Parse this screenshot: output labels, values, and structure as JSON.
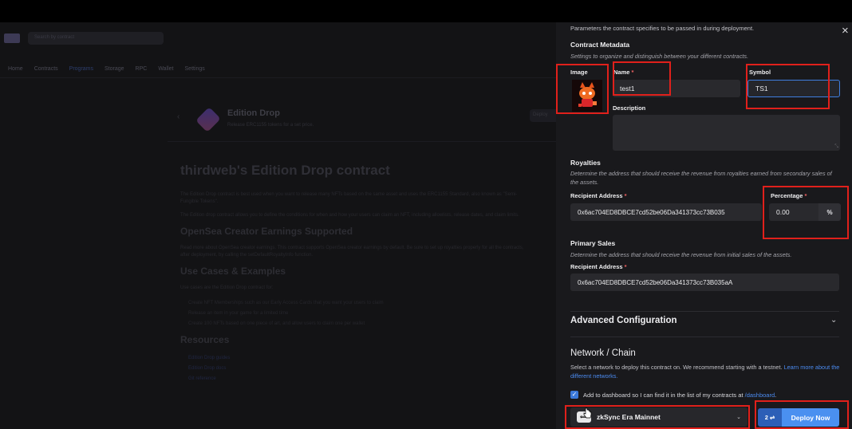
{
  "background": {
    "search_text": "Search by contract",
    "tabs": [
      "Home",
      "Contracts",
      "Programs",
      "Storage",
      "RPC",
      "Wallet",
      "Settings"
    ],
    "card_title": "Edition Drop",
    "card_sub": "Release ERC1155 tokens for a set price.",
    "card_button": "Deploy",
    "h1": "thirdweb's Edition Drop contract",
    "para1": "The Edition Drop contract is best used when you want to release many NFTs based on the same asset and uses the ERC1155 Standard, also known as \"Semi-Fungible Tokens\".",
    "para2": "The Edition drop contract allows you to define the conditions for when and how your users can claim an NFT, including allowlists, release dates, and claim limits.",
    "h2a": "OpenSea Creator Earnings Supported",
    "para3": "Read more about OpenSea creator earnings. This contract supports OpenSea creator earnings by default. Be sure to set up royalties properly for all the contracts, after deployment, by calling the setDefaultRoyaltyInfo function.",
    "h2b": "Use Cases & Examples",
    "para4": "Use cases are the Edition Drop contract for:",
    "list": [
      "Create NFT Memberships such as our Early Access Cards that you want your users to claim",
      "Release an item in your game for a limited time",
      "Create 100 NFTs based on one piece of art, and allow users to claim one per wallet"
    ],
    "h2c": "Resources",
    "links": [
      "Edition Drop guides",
      "Edition Drop docs",
      "Git reference"
    ]
  },
  "drawer": {
    "params_desc": "Parameters the contract specifies to be passed in during deployment.",
    "metadata": {
      "title": "Contract Metadata",
      "desc": "Settings to organize and distinguish between your different contracts.",
      "image_label": "Image",
      "name_label": "Name",
      "name_value": "test1",
      "symbol_label": "Symbol",
      "symbol_value": "TS1",
      "description_label": "Description",
      "description_value": ""
    },
    "royalties": {
      "title": "Royalties",
      "desc": "Determine the address that should receive the revenue from royalties earned from secondary sales of the assets.",
      "recipient_label": "Recipient Address",
      "recipient_value": "0x6ac704ED8DBCE7cd52be06Da341373cc73B035",
      "percentage_label": "Percentage",
      "percentage_value": "0.00",
      "percent_sign": "%"
    },
    "primary_sales": {
      "title": "Primary Sales",
      "desc": "Determine the address that should receive the revenue from initial sales of the assets.",
      "recipient_label": "Recipient Address",
      "recipient_value": "0x6ac704ED8DBCE7cd52be06Da341373cc73B035aA"
    },
    "advanced": {
      "title": "Advanced Configuration"
    },
    "network": {
      "title": "Network / Chain",
      "desc": "Select a network to deploy this contract on. We recommend starting with a testnet.",
      "learn_more": "Learn more about the different networks.",
      "dashboard_label_prefix": "Add to dashboard so I can find it in the list of my contracts at ",
      "dashboard_link": "/dashboard",
      "dashboard_label_suffix": ".",
      "dashboard_checked": true,
      "chain_value": "zkSync Era Mainnet",
      "chain_logo_text": "⟺"
    },
    "deploy": {
      "gas_label": "2 ⇌",
      "button_label": "Deploy Now"
    },
    "required_marker": " *",
    "close_glyph": "×",
    "resize_glyph": "⤡"
  },
  "colors": {
    "accent": "#4a90f0",
    "annotation": "#e0201b",
    "required": "#f06262"
  }
}
